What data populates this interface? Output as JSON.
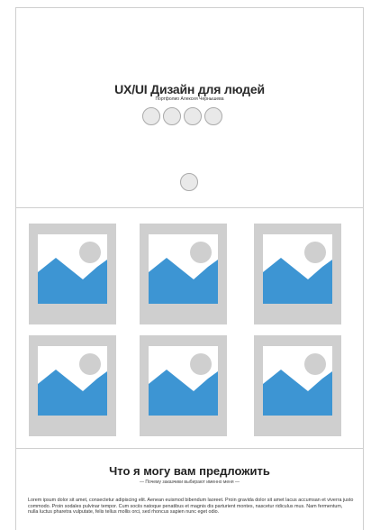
{
  "hero": {
    "title": "UX/UI Дизайн для людей",
    "subtitle": "Портфолио Алексея Чернышева",
    "social_icons": [
      "social-icon-1",
      "social-icon-2",
      "social-icon-3",
      "social-icon-4"
    ],
    "scroll_icon": "scroll-down-icon"
  },
  "gallery": {
    "items": [
      {
        "icon": "image-placeholder-icon"
      },
      {
        "icon": "image-placeholder-icon"
      },
      {
        "icon": "image-placeholder-icon"
      },
      {
        "icon": "image-placeholder-icon"
      },
      {
        "icon": "image-placeholder-icon"
      },
      {
        "icon": "image-placeholder-icon"
      }
    ],
    "colors": {
      "frame": "#cfcfcf",
      "sky": "#ffffff",
      "hill": "#3d95d3",
      "sun": "#cfcfcf"
    }
  },
  "offer": {
    "title": "Что я могу вам предложить",
    "subtitle": "— Почему заказчики выбирают именно меня —",
    "body": "Lorem ipsum dolor sit amet, consectetur adipiscing elit. Aenean euismod bibendum laoreet. Proin gravida dolor sit amet lacus accumsan et viverra justo commodo. Proin sodales pulvinar tempor. Cum sociis natoque penatibus et magnis dis parturient montes, nascetur ridiculus mus. Nam fermentum, nulla luctus pharetra vulputate, felis tellus mollis orci, sed rhoncus sapien nunc eget odio."
  }
}
